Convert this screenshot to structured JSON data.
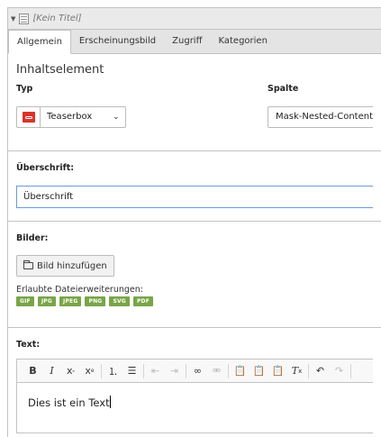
{
  "panel": {
    "title": "[Kein Titel]",
    "icons": {
      "caret": "caret-down-icon",
      "doc": "document-icon"
    }
  },
  "tabs": [
    {
      "label": "Allgemein",
      "active": true
    },
    {
      "label": "Erscheinungsbild",
      "active": false
    },
    {
      "label": "Zugriff",
      "active": false
    },
    {
      "label": "Kategorien",
      "active": false
    }
  ],
  "general": {
    "section_title": "Inhaltselement",
    "typ_label": "Typ",
    "typ_value": "Teaserbox",
    "spalte_label": "Spalte",
    "spalte_value": "Mask-Nested-Content"
  },
  "heading": {
    "label": "Überschrift:",
    "value": "Überschrift"
  },
  "images": {
    "label": "Bilder:",
    "add_button": "Bild hinzufügen",
    "allowed_label": "Erlaubte Dateierweiterungen:",
    "extensions": [
      "GIF",
      "JPG",
      "JPEG",
      "PNG",
      "SVG",
      "PDF"
    ],
    "badge_color": "#79a548"
  },
  "text": {
    "label": "Text:",
    "content": "Dies ist ein Text",
    "toolbar": [
      "bold",
      "italic",
      "subscript",
      "superscript",
      "numbered-list",
      "bulleted-list",
      "outdent",
      "indent",
      "link",
      "unlink",
      "paste",
      "paste-text",
      "paste-word",
      "remove-format",
      "undo",
      "redo"
    ]
  },
  "colors": {
    "accent_border": "#6a9ad6",
    "typ_icon": "#d9342b"
  }
}
